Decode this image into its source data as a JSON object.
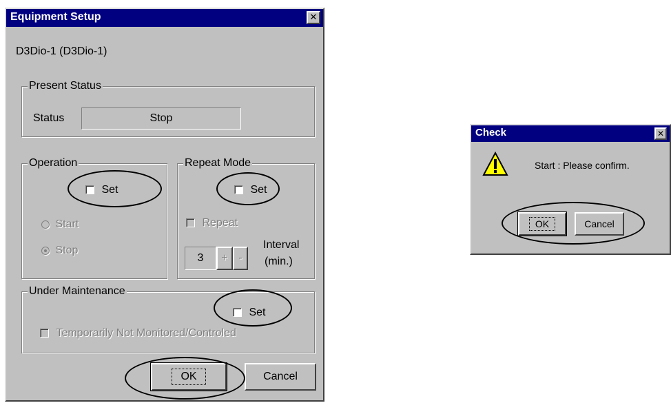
{
  "equipment_setup": {
    "title": "Equipment Setup",
    "close_icon": "close-icon",
    "device_name": "D3Dio-1  (D3Dio-1)",
    "present_status": {
      "legend": "Present Status",
      "status_label": "Status",
      "status_value": "Stop"
    },
    "operation": {
      "legend": "Operation",
      "set_label": "Set",
      "start_label": "Start",
      "stop_label": "Stop",
      "selected": "Stop"
    },
    "repeat_mode": {
      "legend": "Repeat Mode",
      "set_label": "Set",
      "repeat_label": "Repeat",
      "interval_value": "3",
      "plus_label": "+",
      "minus_label": "-",
      "interval_label_1": "Interval",
      "interval_label_2": "(min.)"
    },
    "under_maintenance": {
      "legend": "Under Maintenance",
      "set_label": "Set",
      "not_monitored_label": "Temporarily Not Monitored/Controled"
    },
    "ok_label": "OK",
    "cancel_label": "Cancel"
  },
  "check_dialog": {
    "title": "Check",
    "close_icon": "close-icon",
    "icon": "warning-icon",
    "message": "Start : Please confirm.",
    "ok_label": "OK",
    "cancel_label": "Cancel"
  },
  "colors": {
    "title_bar": "#000080",
    "dialog_face": "#c0c0c0",
    "warning_yellow": "#ffff00"
  }
}
